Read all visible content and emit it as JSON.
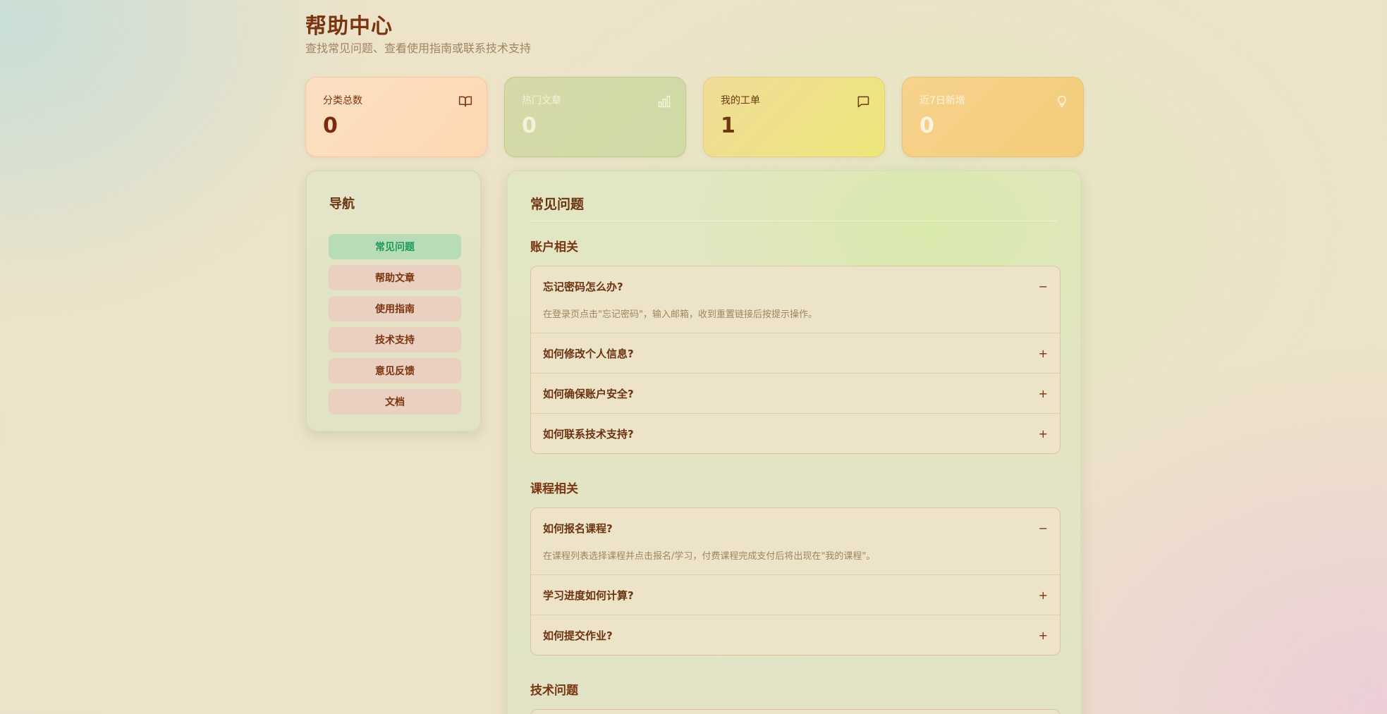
{
  "header": {
    "title": "帮助中心",
    "subtitle": "查找常见问题、查看使用指南或联系技术支持"
  },
  "stats": [
    {
      "label": "分类总数",
      "value": "0",
      "icon": "book-open-icon"
    },
    {
      "label": "热门文章",
      "value": "0",
      "icon": "bar-chart-icon"
    },
    {
      "label": "我的工单",
      "value": "1",
      "icon": "message-square-icon"
    },
    {
      "label": "近7日新增",
      "value": "0",
      "icon": "lightbulb-icon"
    }
  ],
  "nav": {
    "title": "导航",
    "items": [
      {
        "label": "常见问题",
        "active": true
      },
      {
        "label": "帮助文章",
        "active": false
      },
      {
        "label": "使用指南",
        "active": false
      },
      {
        "label": "技术支持",
        "active": false
      },
      {
        "label": "意见反馈",
        "active": false
      },
      {
        "label": "文档",
        "active": false
      }
    ]
  },
  "main": {
    "title": "常见问题",
    "sections": [
      {
        "title": "账户相关",
        "items": [
          {
            "q": "忘记密码怎么办?",
            "a": "在登录页点击\"忘记密码\"，输入邮箱，收到重置链接后按提示操作。",
            "open": true,
            "toggle": "−"
          },
          {
            "q": "如何修改个人信息?",
            "open": false,
            "toggle": "+"
          },
          {
            "q": "如何确保账户安全?",
            "open": false,
            "toggle": "+"
          },
          {
            "q": "如何联系技术支持?",
            "open": false,
            "toggle": "+"
          }
        ]
      },
      {
        "title": "课程相关",
        "items": [
          {
            "q": "如何报名课程?",
            "a": "在课程列表选择课程并点击报名/学习，付费课程完成支付后将出现在\"我的课程\"。",
            "open": true,
            "toggle": "−"
          },
          {
            "q": "学习进度如何计算?",
            "open": false,
            "toggle": "+"
          },
          {
            "q": "如何提交作业?",
            "open": false,
            "toggle": "+"
          }
        ]
      },
      {
        "title": "技术问题",
        "items": []
      }
    ]
  },
  "colors": {
    "accent_text": "#7a3410",
    "active_nav_bg": "#b8dcb8",
    "active_nav_text": "#1d9a5a",
    "muted_text": "#a0855f"
  }
}
